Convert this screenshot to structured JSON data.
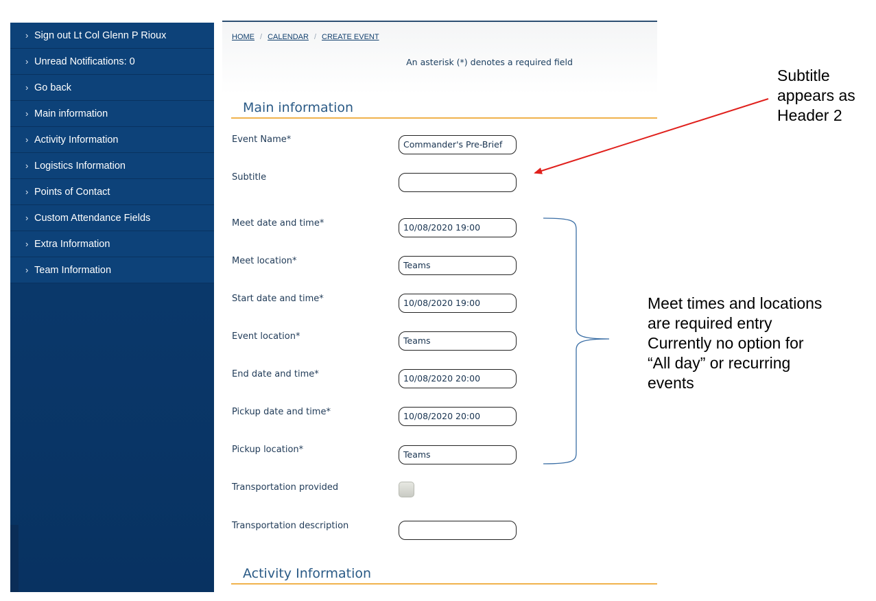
{
  "sidebar": {
    "items": [
      {
        "label": "Sign out Lt Col Glenn P Rioux"
      },
      {
        "label": "Unread Notifications: 0"
      },
      {
        "label": "Go back"
      },
      {
        "label": "Main information"
      },
      {
        "label": "Activity Information"
      },
      {
        "label": "Logistics Information"
      },
      {
        "label": "Points of Contact"
      },
      {
        "label": "Custom Attendance Fields"
      },
      {
        "label": "Extra Information"
      },
      {
        "label": "Team Information"
      }
    ]
  },
  "breadcrumb": [
    "HOME",
    "CALENDAR",
    "CREATE EVENT"
  ],
  "breadcrumb_separator": "/",
  "required_note": "An asterisk (*) denotes a required field",
  "sections": {
    "main": "Main information",
    "activity": "Activity Information"
  },
  "fields": [
    {
      "label": "Event Name*",
      "value": "Commander's Pre-Brief"
    },
    {
      "label": "Subtitle",
      "value": ""
    },
    {
      "label": "Meet date and time*",
      "value": "10/08/2020 19:00"
    },
    {
      "label": "Meet location*",
      "value": "Teams"
    },
    {
      "label": "Start date and time*",
      "value": "10/08/2020 19:00"
    },
    {
      "label": "Event location*",
      "value": "Teams"
    },
    {
      "label": "End date and time*",
      "value": "10/08/2020 20:00"
    },
    {
      "label": "Pickup date and time*",
      "value": "10/08/2020 20:00"
    },
    {
      "label": "Pickup location*",
      "value": "Teams"
    },
    {
      "label": "Transportation provided",
      "checked": false
    },
    {
      "label": "Transportation description",
      "value": ""
    }
  ],
  "annotations": {
    "subtitle_note": [
      "Subtitle",
      "appears as",
      "Header 2"
    ],
    "meet_note": [
      "Meet times and locations",
      "are required entry",
      "Currently no option for",
      "“All day” or recurring",
      "events"
    ]
  },
  "colors": {
    "sidebar_bg": "#0d4279",
    "section_rule": "#f0b24c",
    "arrow": "#e0201c",
    "brace": "#3a6ea5"
  },
  "icons": {
    "sidebar_chevron": "chevron-right-icon"
  }
}
